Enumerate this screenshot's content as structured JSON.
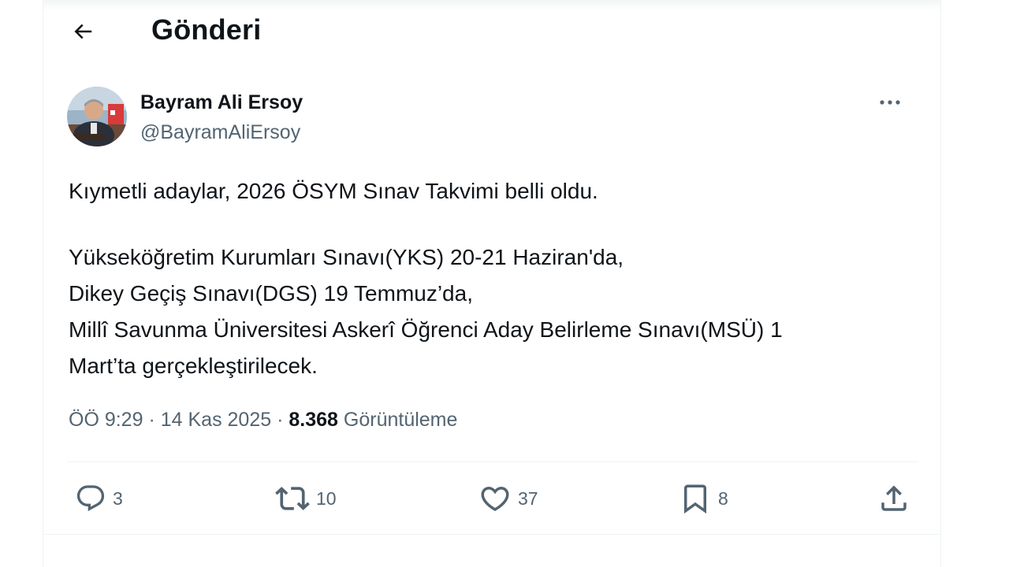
{
  "header": {
    "title": "Gönderi"
  },
  "author": {
    "name": "Bayram Ali Ersoy",
    "handle": "@BayramAliErsoy"
  },
  "tweet": {
    "lines_block1": [
      "Kıymetli adaylar, 2026 ÖSYM Sınav Takvimi belli oldu."
    ],
    "lines_block2": [
      "Yükseköğretim Kurumları Sınavı(YKS) 20-21 Haziran'da,",
      "Dikey Geçiş Sınavı(DGS) 19 Temmuz’da,",
      "Millî Savunma Üniversitesi Askerî Öğrenci Aday Belirleme Sınavı(MSÜ) 1",
      "Mart’ta gerçekleştirilecek."
    ]
  },
  "meta": {
    "time": "ÖÖ 9:29",
    "separator": "·",
    "date": "14 Kas 2025",
    "views_count": "8.368",
    "views_label": "Görüntüleme"
  },
  "actions": {
    "replies": "3",
    "reposts": "10",
    "likes": "37",
    "bookmarks": "8"
  },
  "icons": {
    "back": "arrow-left-icon",
    "more": "more-dots-icon",
    "reply": "reply-icon",
    "repost": "repost-icon",
    "like": "heart-icon",
    "bookmark": "bookmark-icon",
    "share": "share-icon"
  },
  "colors": {
    "text": "#0f1419",
    "secondary": "#536471",
    "border": "#eff3f4"
  }
}
